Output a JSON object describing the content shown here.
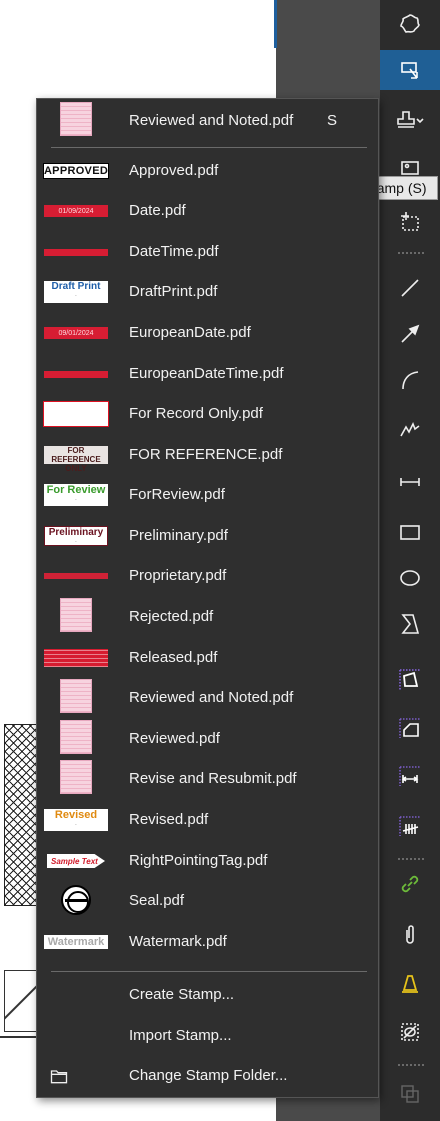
{
  "tooltip": "Stamp (S)",
  "menu": {
    "items": [
      {
        "label": "Reviewed and Noted.pdf",
        "shortcut": "S",
        "thumb": "pink"
      },
      {
        "label": "Approved.pdf",
        "thumb": "approved",
        "thumb_text": "APPROVED"
      },
      {
        "label": "Date.pdf",
        "thumb": "redbar",
        "thumb_text": "01/09/2024"
      },
      {
        "label": "DateTime.pdf",
        "thumb": "redbar"
      },
      {
        "label": "DraftPrint.pdf",
        "thumb": "draft",
        "thumb_text": "Draft Print"
      },
      {
        "label": "EuropeanDate.pdf",
        "thumb": "redbar",
        "thumb_text": "09/01/2024"
      },
      {
        "label": "EuropeanDateTime.pdf",
        "thumb": "redbar"
      },
      {
        "label": "For Record Only.pdf",
        "thumb": "record"
      },
      {
        "label": "FOR REFERENCE.pdf",
        "thumb": "forref",
        "thumb_text": "FOR REFERENCE ONLY"
      },
      {
        "label": "ForReview.pdf",
        "thumb": "review",
        "thumb_text": "For Review"
      },
      {
        "label": "Preliminary.pdf",
        "thumb": "prelim",
        "thumb_text": "Preliminary"
      },
      {
        "label": "Proprietary.pdf",
        "thumb": "prop"
      },
      {
        "label": "Rejected.pdf",
        "thumb": "pink"
      },
      {
        "label": "Released.pdf",
        "thumb": "released"
      },
      {
        "label": "Reviewed and Noted.pdf",
        "thumb": "pink"
      },
      {
        "label": "Reviewed.pdf",
        "thumb": "pink"
      },
      {
        "label": "Revise and Resubmit.pdf",
        "thumb": "pink"
      },
      {
        "label": "Revised.pdf",
        "thumb": "revised",
        "thumb_text": "Revised"
      },
      {
        "label": "RightPointingTag.pdf",
        "thumb": "tag",
        "thumb_text": "Sample Text"
      },
      {
        "label": "Seal.pdf",
        "thumb": "seal"
      },
      {
        "label": "Watermark.pdf",
        "thumb": "water",
        "thumb_text": "Watermark"
      }
    ],
    "actions": {
      "create": "Create Stamp...",
      "import": "Import Stamp...",
      "change_folder": "Change Stamp Folder..."
    }
  },
  "toolbar": {
    "icons": [
      "lasso-icon",
      "select-icon",
      "stamp-icon",
      "image-icon",
      "crop-icon",
      "line-icon",
      "arrow-icon",
      "arc-icon",
      "polyline-icon",
      "dimension-icon",
      "rectangle-icon",
      "ellipse-icon",
      "polygon-icon",
      "area-measure-icon",
      "perimeter-icon",
      "length-icon",
      "count-icon",
      "hyperlink-icon",
      "attachment-icon",
      "alert-icon",
      "hide-icon",
      "group-icon"
    ],
    "colors": {
      "active": "#1f5f95",
      "link_green": "#6dbb3a",
      "alert_yellow": "#e6c21a",
      "measure_purple": "#7a5cc7"
    }
  }
}
